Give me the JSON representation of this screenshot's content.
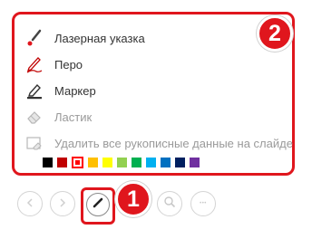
{
  "menu": {
    "items": [
      {
        "label": "Лазерная указка",
        "icon": "laser-pointer-icon",
        "enabled": true
      },
      {
        "label": "Перо",
        "icon": "pen-icon",
        "enabled": true
      },
      {
        "label": "Маркер",
        "icon": "highlighter-icon",
        "enabled": true
      },
      {
        "label": "Ластик",
        "icon": "eraser-icon",
        "enabled": false
      },
      {
        "label": "Удалить все рукописные данные на слайде",
        "icon": "erase-all-ink-icon",
        "enabled": false
      }
    ],
    "colors": [
      "#000000",
      "#c00000",
      "#ff0000",
      "#ffc000",
      "#ffff00",
      "#92d050",
      "#00b050",
      "#00b0f0",
      "#0070c0",
      "#002060",
      "#7030a0"
    ],
    "selected_color_index": 2
  },
  "badges": {
    "one": "1",
    "two": "2"
  },
  "toolbar": {
    "more_label": "•••"
  },
  "accent": "#e0161d"
}
